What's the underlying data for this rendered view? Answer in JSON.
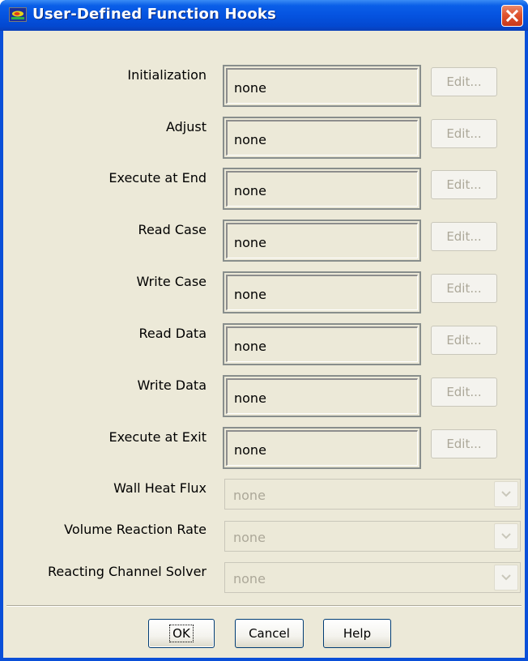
{
  "window": {
    "title": "User-Defined Function Hooks",
    "title_icon": "fluent-app-icon",
    "close_icon": "close-icon"
  },
  "hooks": [
    {
      "label": "Initialization",
      "value": "none",
      "edit_label": "Edit...",
      "edit_enabled": false
    },
    {
      "label": "Adjust",
      "value": "none",
      "edit_label": "Edit...",
      "edit_enabled": false
    },
    {
      "label": "Execute at End",
      "value": "none",
      "edit_label": "Edit...",
      "edit_enabled": false
    },
    {
      "label": "Read Case",
      "value": "none",
      "edit_label": "Edit...",
      "edit_enabled": false
    },
    {
      "label": "Write Case",
      "value": "none",
      "edit_label": "Edit...",
      "edit_enabled": false
    },
    {
      "label": "Read Data",
      "value": "none",
      "edit_label": "Edit...",
      "edit_enabled": false
    },
    {
      "label": "Write Data",
      "value": "none",
      "edit_label": "Edit...",
      "edit_enabled": false
    },
    {
      "label": "Execute at Exit",
      "value": "none",
      "edit_label": "Edit...",
      "edit_enabled": false
    }
  ],
  "dropdowns": [
    {
      "label": "Wall Heat Flux",
      "value": "none",
      "enabled": false
    },
    {
      "label": "Volume Reaction Rate",
      "value": "none",
      "enabled": false
    },
    {
      "label": "Reacting Channel Solver",
      "value": "none",
      "enabled": false
    }
  ],
  "buttons": {
    "ok": "OK",
    "cancel": "Cancel",
    "help": "Help"
  },
  "colors": {
    "titlebar": "#0553e0",
    "dialog_bg": "#ece9d8",
    "disabled_text": "#aca899",
    "close_button": "#e0542e"
  }
}
